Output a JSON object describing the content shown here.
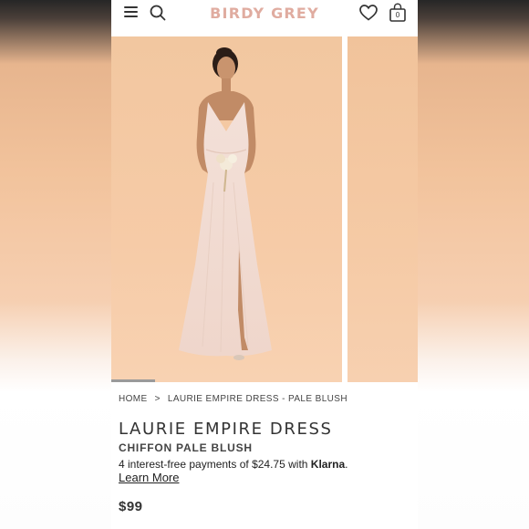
{
  "header": {
    "logo": "BIRDY GREY",
    "cart_count": "0",
    "icons": [
      "menu-icon",
      "search-icon",
      "heart-icon",
      "shopping-bag-icon"
    ]
  },
  "gallery": {
    "slides": [
      {
        "alt": "Model wearing Laurie Empire Dress in pale blush"
      },
      {
        "alt": "Next product image"
      }
    ],
    "progress": 0.19
  },
  "breadcrumb": {
    "home": "HOME",
    "separator": ">",
    "current": "LAURIE EMPIRE DRESS - PALE BLUSH"
  },
  "product": {
    "title": "LAURIE EMPIRE DRESS",
    "subtitle": "CHIFFON PALE BLUSH",
    "installments_text": "4 interest-free payments of $24.75 with ",
    "klarna": "Klarna",
    "klarna_suffix": ".",
    "learn_more": "Learn More",
    "price": "$99"
  },
  "colors": {
    "logo": "#e0aca0",
    "backdrop": "#f3c9a4",
    "dress": "#f2ddd4"
  }
}
